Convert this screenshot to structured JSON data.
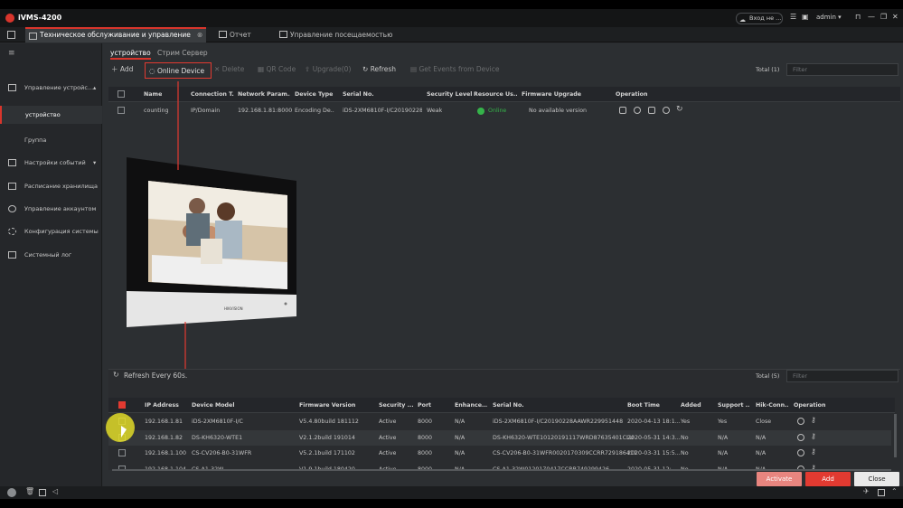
{
  "app": {
    "title": "iVMS-4200",
    "login_label": "Вход не ...",
    "user": "admin"
  },
  "tabs": [
    {
      "label": "Техническое обслуживание и управление"
    },
    {
      "label": "Отчет"
    },
    {
      "label": "Управление посещаемостью"
    }
  ],
  "sidebar": {
    "items": [
      {
        "label": "Управление устройс..."
      },
      {
        "label": "устройство"
      },
      {
        "label": "Группа"
      },
      {
        "label": "Настройки событий"
      },
      {
        "label": "Расписание хранилища"
      },
      {
        "label": "Управление аккаунтом"
      },
      {
        "label": "Конфигурация системы"
      },
      {
        "label": "Системный лог"
      }
    ]
  },
  "subtabs": [
    "устройство",
    "Стрим Сервер"
  ],
  "toolbar": {
    "add": "Add",
    "online_device": "Online Device",
    "delete": "Delete",
    "qr_code": "QR Code",
    "upgrade": "Upgrade(0)",
    "refresh": "Refresh",
    "get_events": "Get Events from Device",
    "total": "Total (1)",
    "filter_placeholder": "Filter"
  },
  "device_table": {
    "headers": [
      "Name",
      "Connection T...",
      "Network Param...",
      "Device Type",
      "Serial No.",
      "Security Level",
      "Resource Us...",
      "Firmware Upgrade",
      "Operation"
    ],
    "rows": [
      [
        "counting",
        "IP/Domain",
        "192.168.1.81:8000",
        "Encoding De...",
        "iDS-2XM6810F-I/C20190228...",
        "Weak",
        "Online",
        "No available version"
      ]
    ]
  },
  "online_panel": {
    "refresh_label": "Refresh Every 60s.",
    "total": "Total (5)",
    "filter_placeholder": "Filter",
    "headers": [
      "IP Address",
      "Device Model",
      "Firmware Version",
      "Security ...",
      "Port",
      "Enhance...",
      "Serial No.",
      "Boot Time",
      "Added",
      "Support ...",
      "Hik-Conn...",
      "Operation"
    ],
    "rows": [
      [
        "192.168.1.81",
        "iDS-2XM6810F-I/C",
        "V5.4.80build 181112",
        "Active",
        "8000",
        "N/A",
        "iDS-2XM6810F-I/C20190228AAWR229951448",
        "2020-04-13 18:1...",
        "Yes",
        "Yes",
        "Close"
      ],
      [
        "192.168.1.82",
        "DS-KH6320-WTE1",
        "V2.1.2build 191014",
        "Active",
        "8000",
        "N/A",
        "DS-KH6320-WTE10120191117WRD87635401CLU",
        "2020-05-31 14:3...",
        "No",
        "N/A",
        "N/A"
      ],
      [
        "192.168.1.100",
        "CS-CV206-B0-31WFR",
        "V5.2.1build 171102",
        "Active",
        "8000",
        "N/A",
        "CS-CV206-B0-31WFR0020170309CCRR729186411",
        "2020-03-31 15:5...",
        "No",
        "N/A",
        "N/A"
      ],
      [
        "192.168.1.104",
        "CS-A1-32W",
        "V1.9.1build 180420",
        "Active",
        "8000",
        "N/A",
        "CS-A1-32W0120170417CCRR749299426",
        "2020-05-31 12:...",
        "No",
        "N/A",
        "N/A"
      ]
    ],
    "activate": "Activate",
    "add": "Add",
    "close": "Close"
  },
  "device_brand": "HIKVISION",
  "colors": {
    "accent": "#d9352c",
    "online": "#35b34a",
    "activate_disabled": "#e8857f",
    "add_button": "#e23a31"
  }
}
